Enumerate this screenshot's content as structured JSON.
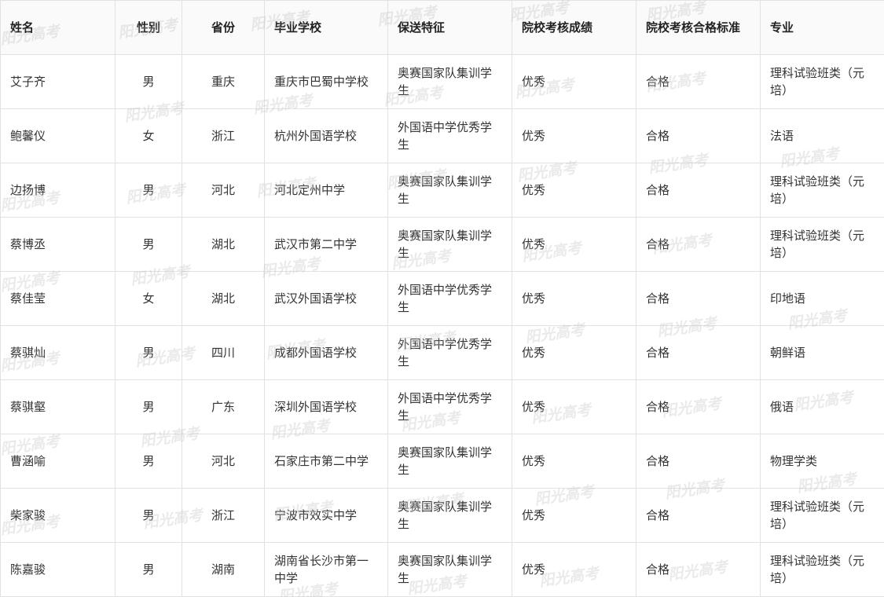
{
  "table": {
    "headers": [
      "姓名",
      "性别",
      "省份",
      "毕业学校",
      "保送特征",
      "院校考核成绩",
      "院校考核合格标准",
      "专业"
    ],
    "rows": [
      [
        "艾子齐",
        "男",
        "重庆",
        "重庆市巴蜀中学校",
        "奥赛国家队集训学生",
        "优秀",
        "合格",
        "理科试验班类（元培）"
      ],
      [
        "鲍馨仪",
        "女",
        "浙江",
        "杭州外国语学校",
        "外国语中学优秀学生",
        "优秀",
        "合格",
        "法语"
      ],
      [
        "边扬博",
        "男",
        "河北",
        "河北定州中学",
        "奥赛国家队集训学生",
        "优秀",
        "合格",
        "理科试验班类（元培）"
      ],
      [
        "蔡博丞",
        "男",
        "湖北",
        "武汉市第二中学",
        "奥赛国家队集训学生",
        "优秀",
        "合格",
        "理科试验班类（元培）"
      ],
      [
        "蔡佳莹",
        "女",
        "湖北",
        "武汉外国语学校",
        "外国语中学优秀学生",
        "优秀",
        "合格",
        "印地语"
      ],
      [
        "蔡骐灿",
        "男",
        "四川",
        "成都外国语学校",
        "外国语中学优秀学生",
        "优秀",
        "合格",
        "朝鲜语"
      ],
      [
        "蔡骐壑",
        "男",
        "广东",
        "深圳外国语学校",
        "外国语中学优秀学生",
        "优秀",
        "合格",
        "俄语"
      ],
      [
        "曹涵喻",
        "男",
        "河北",
        "石家庄市第二中学",
        "奥赛国家队集训学生",
        "优秀",
        "合格",
        "物理学类"
      ],
      [
        "柴家骏",
        "男",
        "浙江",
        "宁波市效实中学",
        "奥赛国家队集训学生",
        "优秀",
        "合格",
        "理科试验班类（元培）"
      ],
      [
        "陈嘉骏",
        "男",
        "湖南",
        "湖南省长沙市第一中学",
        "奥赛国家队集训学生",
        "优秀",
        "合格",
        "理科试验班类（元培）"
      ]
    ]
  },
  "watermark": {
    "text": "阳光高考",
    "color": "#bebebe"
  }
}
